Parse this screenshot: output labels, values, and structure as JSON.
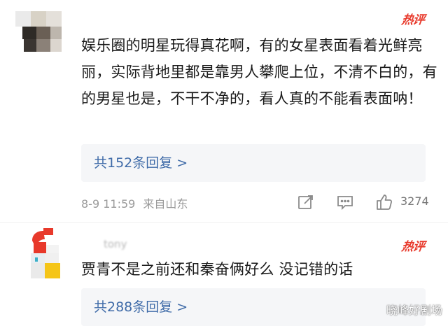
{
  "comments": [
    {
      "badge": "热评",
      "text": "娱乐圈的明星玩得真花啊，有的女星表面看着光鲜亮丽，实际背地里都是靠男人攀爬上位，不清不白的，有的男星也是，不干不净的，看人真的不能看表面呐！",
      "replies_label": "共152条回复 >",
      "timestamp": "8-9 11:59",
      "location": "来自山东",
      "like_count": "3274",
      "icons": [
        "share-icon",
        "comment-icon",
        "like-icon"
      ]
    },
    {
      "username": "tony",
      "badge": "热评",
      "text": "贾青不是之前还和秦奋俩好么 没记错的话",
      "replies_label": "共288条回复 >"
    }
  ],
  "watermark": "晓峰好剧场",
  "colors": {
    "badge": "#e8392b",
    "link": "#3f6ba8",
    "reply_bg": "#f5f6f8",
    "meta": "#9a9a9a"
  }
}
